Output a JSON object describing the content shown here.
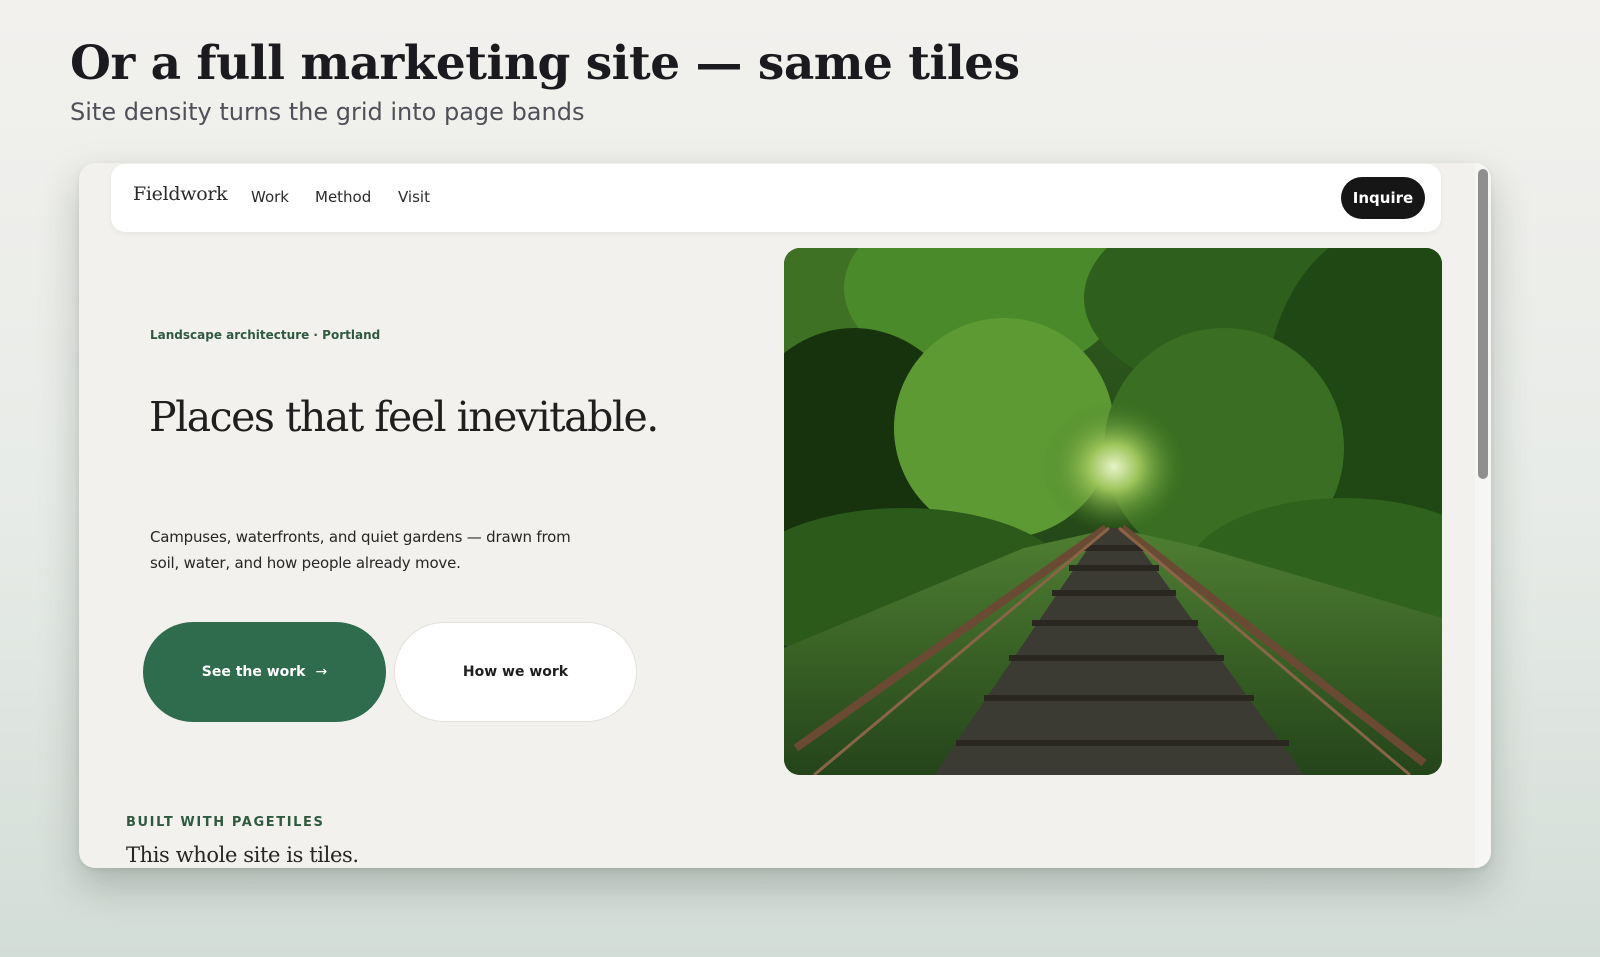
{
  "slide": {
    "title": "Or a full marketing site — same tiles",
    "subtitle": "Site density turns the grid into page bands"
  },
  "site": {
    "nav": {
      "brand": "Fieldwork",
      "links": [
        "Work",
        "Method",
        "Visit"
      ],
      "cta_label": "Inquire"
    },
    "hero": {
      "eyebrow": "Landscape architecture · Portland",
      "headline": "Places that feel inevitable.",
      "description": "Campuses, waterfronts, and quiet gardens — drawn from soil, water, and how people already move.",
      "primary_button_label": "See the work",
      "primary_button_arrow": "→",
      "secondary_button_label": "How we work"
    },
    "section": {
      "eyebrow": "BUILT WITH PAGETILES",
      "title": "This whole site is tiles."
    }
  },
  "colors": {
    "accent_green": "#2f6b4d",
    "eyebrow_green": "#2e5a3f",
    "cta_dark": "#161616",
    "page_background": "#f2f1ed"
  }
}
